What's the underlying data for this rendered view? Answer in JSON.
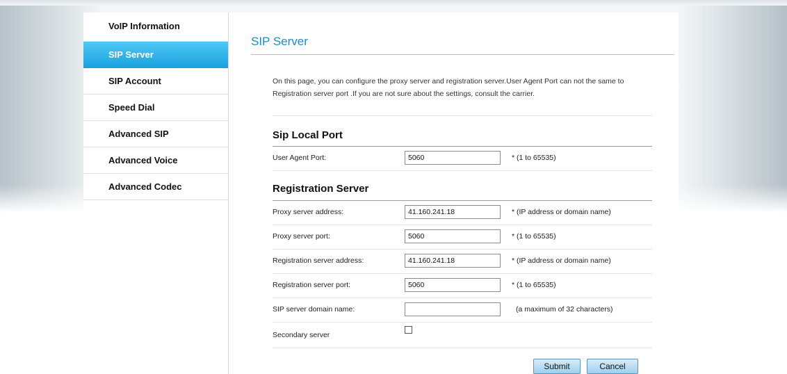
{
  "sidebar": {
    "items": [
      {
        "label": "VoIP Information"
      },
      {
        "label": "SIP Server"
      },
      {
        "label": "SIP Account"
      },
      {
        "label": "Speed Dial"
      },
      {
        "label": "Advanced SIP"
      },
      {
        "label": "Advanced Voice"
      },
      {
        "label": "Advanced Codec"
      }
    ],
    "active_item": "SIP Server"
  },
  "main": {
    "title": "SIP Server",
    "description": "On this page, you can configure the proxy server and registration server.User Agent Port can not the same to Registration server port .If you are not sure about the settings, consult the carrier.",
    "local_port": {
      "title": "Sip Local Port",
      "user_agent_port": {
        "label": "User Agent Port:",
        "value": "5060",
        "hint": "*  (1 to 65535)"
      }
    },
    "registration": {
      "title": "Registration Server",
      "rows": [
        {
          "label": "Proxy server address:",
          "value": "41.160.241.18",
          "hint": "*  (IP address or domain name)"
        },
        {
          "label": "Proxy server port:",
          "value": "5060",
          "hint": "*  (1 to 65535)"
        },
        {
          "label": "Registration server address:",
          "value": "41.160.241.18",
          "hint": "*  (IP address or domain name)"
        },
        {
          "label": "Registration server port:",
          "value": "5060",
          "hint": "*  (1 to 65535)"
        },
        {
          "label": "SIP server domain name:",
          "value": "",
          "hint": "(a maximum of 32 characters)"
        }
      ],
      "secondary": {
        "label": "Secondary server",
        "checked": false
      }
    },
    "buttons": {
      "submit": "Submit",
      "cancel": "Cancel"
    }
  },
  "colors": {
    "accent": "#1aa3e0",
    "title": "#1a8ccd"
  }
}
